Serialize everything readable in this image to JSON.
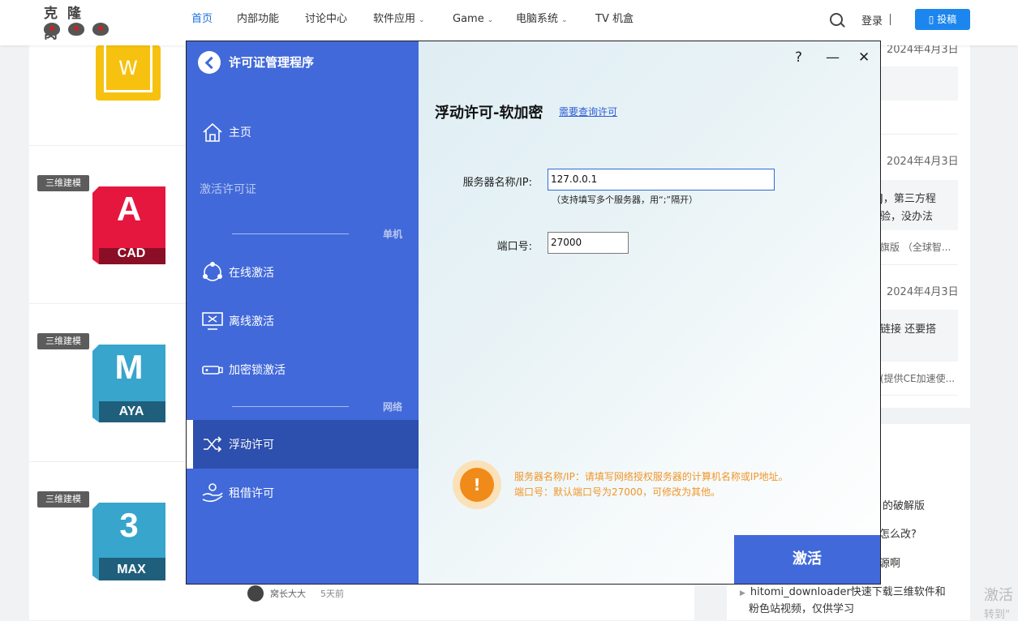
{
  "site": {
    "logo_text": "克隆窝",
    "nav": [
      {
        "label": "首页",
        "active": true,
        "caret": false
      },
      {
        "label": "内部功能",
        "active": false,
        "caret": false
      },
      {
        "label": "讨论中心",
        "active": false,
        "caret": false
      },
      {
        "label": "软件应用",
        "active": false,
        "caret": true
      },
      {
        "label": "Game",
        "active": false,
        "caret": true
      },
      {
        "label": "电脑系统",
        "active": false,
        "caret": true
      },
      {
        "label": "TV 机盒",
        "active": false,
        "caret": false
      }
    ],
    "login_label": "登录",
    "post_label": "▯ 投稿",
    "accent": "#1c86ee"
  },
  "posts": [
    {
      "badge": "",
      "icon": "word-icon",
      "icon_letter": "W"
    },
    {
      "badge": "三维建模",
      "icon": "autocad-icon",
      "big": "A",
      "small": "CAD",
      "color": "#e5173f"
    },
    {
      "badge": "三维建模",
      "icon": "maya-icon",
      "big": "M",
      "small": "AYA",
      "color": "#37a5cc"
    },
    {
      "badge": "三维建模",
      "icon": "3dsmax-icon",
      "big": "3",
      "small": "MAX",
      "color": "#37a5cc"
    }
  ],
  "author": {
    "name": "窝长大大",
    "time": "5天前"
  },
  "sidebar": {
    "dates": [
      "2024年4月3日",
      "2024年4月3日",
      "2024年4月3日"
    ],
    "snippets": [
      "J，第三方程",
      "验，没办法",
      "旗版 （全球智...",
      "链接 还要搭",
      "(提供CE加速使..."
    ],
    "list": [
      "的破解版",
      "怎么改?",
      "源啊",
      "hitomi_downloader快速下载三维软件和",
      "粉色站视频，仅供学习"
    ],
    "watermark": "激活",
    "watermark_sub": "转到\""
  },
  "license_window": {
    "title": "许可证管理程序",
    "controls": {
      "help": "?",
      "minimize": "—",
      "close": "✕"
    },
    "menu": {
      "home": "主页",
      "activate_header": "激活许可证",
      "section_single": "单机",
      "online": "在线激活",
      "offline": "离线激活",
      "dongle": "加密锁激活",
      "section_network": "网络",
      "floating": "浮动许可",
      "borrow": "租借许可"
    },
    "main": {
      "title": "浮动许可-软加密",
      "query_link": "需要查询许可",
      "server_label": "服务器名称/IP:",
      "server_value": "127.0.0.1",
      "server_hint": "（支持填写多个服务器，用“;”隔开）",
      "port_label": "端口号:",
      "port_value": "27000",
      "info_line1": "服务器名称/IP：请填写网络授权服务器的计算机名称或IP地址。",
      "info_line2": "端口号：默认端口号为27000，可修改为其他。",
      "activate_button": "激活"
    },
    "colors": {
      "sidebar": "#4169d9",
      "active_item": "#2d4fad",
      "warning": "#f08a18"
    }
  }
}
